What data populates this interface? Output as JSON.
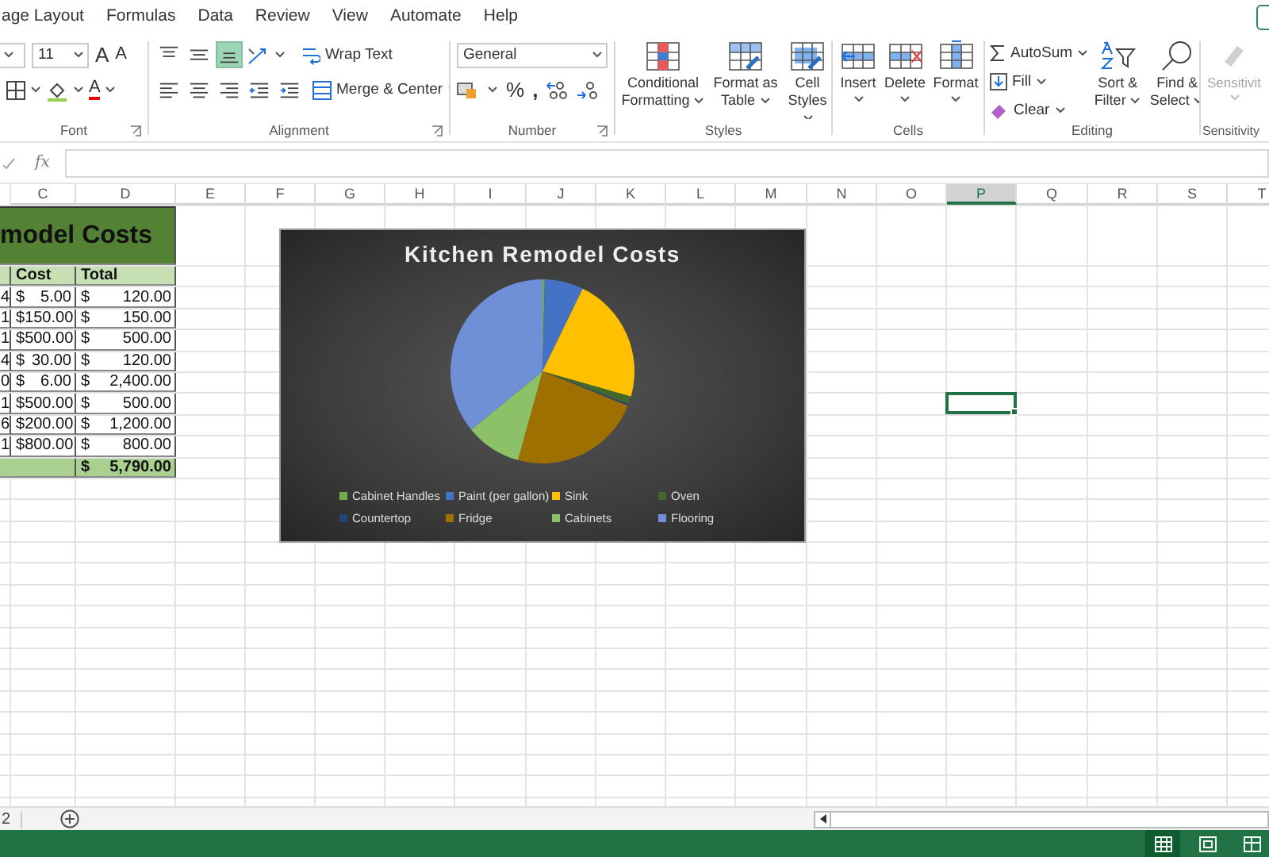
{
  "menu_tabs": [
    {
      "label": "age Layout",
      "selected": false
    },
    {
      "label": "Formulas",
      "selected": false
    },
    {
      "label": "Data",
      "selected": false
    },
    {
      "label": "Review",
      "selected": false
    },
    {
      "label": "View",
      "selected": false
    },
    {
      "label": "Automate",
      "selected": false
    },
    {
      "label": "Help",
      "selected": false
    }
  ],
  "ribbon": {
    "font": {
      "size": "11",
      "grow": "A",
      "shrink": "A",
      "color_letter": "A",
      "label": "Font"
    },
    "alignment": {
      "row_1": [
        {
          "kind": "align-top",
          "selected": false
        },
        {
          "kind": "align-middle",
          "selected": false
        },
        {
          "kind": "align-bottom",
          "selected": true
        }
      ],
      "row_2": [
        {
          "kind": "align-left",
          "selected": false
        },
        {
          "kind": "align-center",
          "selected": false
        },
        {
          "kind": "align-right",
          "selected": false
        },
        {
          "kind": "indent-decrease",
          "selected": false
        },
        {
          "kind": "indent-increase",
          "selected": false
        }
      ],
      "wrap_text": "Wrap Text",
      "merge": "Merge & Center",
      "label": "Alignment"
    },
    "number": {
      "format": "General",
      "percent": "%",
      "comma": ",",
      "label": "Number"
    },
    "styles": {
      "buttons": [
        {
          "kind": "conditional",
          "label": "Conditional Formatting"
        },
        {
          "kind": "table",
          "label": "Format as Table"
        },
        {
          "kind": "cell-styles",
          "label": "Cell Styles"
        }
      ],
      "label": "Styles"
    },
    "cells": {
      "buttons": [
        {
          "kind": "insert",
          "label": "Insert"
        },
        {
          "kind": "delete",
          "label": "Delete"
        },
        {
          "kind": "format",
          "label": "Format"
        }
      ],
      "label": "Cells"
    },
    "editing": {
      "autosum": "AutoSum",
      "fill": "Fill",
      "clear": "Clear",
      "sort": "Sort & Filter",
      "find": "Find & Select",
      "label": "Editing"
    },
    "sensitivity": {
      "button": "Sensitivit",
      "label": "Sensitivity",
      "disabled": true
    }
  },
  "formula_bar": {
    "fx": "fx"
  },
  "sheet": {
    "columns": [
      {
        "label": "C",
        "selected": false
      },
      {
        "label": "D",
        "selected": false
      },
      {
        "label": "E",
        "selected": false
      },
      {
        "label": "F",
        "selected": false
      },
      {
        "label": "G",
        "selected": false
      },
      {
        "label": "H",
        "selected": false
      },
      {
        "label": "I",
        "selected": false
      },
      {
        "label": "J",
        "selected": false
      },
      {
        "label": "K",
        "selected": false
      },
      {
        "label": "L",
        "selected": false
      },
      {
        "label": "M",
        "selected": false
      },
      {
        "label": "N",
        "selected": false
      },
      {
        "label": "O",
        "selected": false
      },
      {
        "label": "P",
        "selected": true
      },
      {
        "label": "Q",
        "selected": false
      },
      {
        "label": "R",
        "selected": false
      },
      {
        "label": "S",
        "selected": false
      },
      {
        "label": "T",
        "selected": false
      }
    ],
    "table": {
      "title": "model Costs",
      "headers": [
        "Cost",
        "Total"
      ],
      "rows": [
        {
          "qty": "4",
          "cost": {
            "symbol": "$",
            "amount": "5.00"
          },
          "total": {
            "symbol": "$",
            "amount": "120.00"
          },
          "selected": false
        },
        {
          "qty": "1",
          "cost": {
            "symbol": "$",
            "amount": "150.00"
          },
          "total": {
            "symbol": "$",
            "amount": "150.00"
          },
          "selected": false
        },
        {
          "qty": "1",
          "cost": {
            "symbol": "$",
            "amount": "500.00"
          },
          "total": {
            "symbol": "$",
            "amount": "500.00"
          },
          "selected": false
        },
        {
          "qty": "4",
          "cost": {
            "symbol": "$",
            "amount": "30.00"
          },
          "total": {
            "symbol": "$",
            "amount": "120.00"
          },
          "selected": false
        },
        {
          "qty": "0",
          "cost": {
            "symbol": "$",
            "amount": "6.00"
          },
          "total": {
            "symbol": "$",
            "amount": "2,400.00"
          },
          "selected": false
        },
        {
          "qty": "1",
          "cost": {
            "symbol": "$",
            "amount": "500.00"
          },
          "total": {
            "symbol": "$",
            "amount": "500.00"
          },
          "selected": true
        },
        {
          "qty": "6",
          "cost": {
            "symbol": "$",
            "amount": "200.00"
          },
          "total": {
            "symbol": "$",
            "amount": "1,200.00"
          },
          "selected": false
        },
        {
          "qty": "1",
          "cost": {
            "symbol": "$",
            "amount": "800.00"
          },
          "total": {
            "symbol": "$",
            "amount": "800.00"
          },
          "selected": false
        }
      ],
      "total": {
        "symbol": "$",
        "amount": "5,790.00"
      }
    }
  },
  "chart": {
    "title": "Kitchen Remodel Costs",
    "legend": [
      {
        "label": "Cabinet Handles",
        "color": "#70ad47"
      },
      {
        "label": "Paint (per gallon)",
        "color": "#4472c4"
      },
      {
        "label": "Sink",
        "color": "#ffc000"
      },
      {
        "label": "Oven",
        "color": "#43682b"
      },
      {
        "label": "Countertop",
        "color": "#264478"
      },
      {
        "label": "Fridge",
        "color": "#9e7000"
      },
      {
        "label": "Cabinets",
        "color": "#8cc168"
      },
      {
        "label": "Flooring",
        "color": "#6f8fd6"
      }
    ]
  },
  "sheet_tabs": {
    "tab": "2"
  },
  "status_bar": {
    "views": [
      {
        "kind": "normal",
        "selected": true
      },
      {
        "kind": "page-layout",
        "selected": false
      },
      {
        "kind": "page-break",
        "selected": false
      }
    ]
  }
}
